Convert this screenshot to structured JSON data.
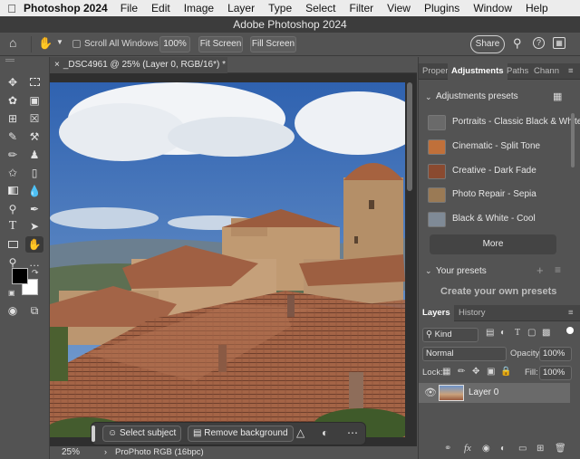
{
  "menubar": {
    "apple": "",
    "app": "Photoshop 2024",
    "items": [
      "File",
      "Edit",
      "Image",
      "Layer",
      "Type",
      "Select",
      "Filter",
      "View",
      "Plugins",
      "Window",
      "Help"
    ]
  },
  "window": {
    "title": "Adobe Photoshop 2024"
  },
  "options": {
    "scroll_all_windows": "Scroll All Windows",
    "zoom_100": "100%",
    "fit_screen": "Fit Screen",
    "fill_screen": "Fill Screen",
    "share": "Share"
  },
  "document": {
    "tab_label": "_DSC4961 @ 25% (Layer 0, RGB/16*) *",
    "zoom": "25%",
    "profile": "ProPhoto RGB (16bpc)"
  },
  "taskbar": {
    "select_subject": "Select subject",
    "remove_background": "Remove background"
  },
  "panels": {
    "top_tabs": [
      "Proper",
      "Adjustments",
      "Paths",
      "Chann"
    ],
    "adjustments_presets_title": "Adjustments presets",
    "presets": [
      {
        "label": "Portraits - Classic Black & White",
        "thumb": "#6a6a6a"
      },
      {
        "label": "Cinematic - Split Tone",
        "thumb": "#c0703a"
      },
      {
        "label": "Creative - Dark Fade",
        "thumb": "#8a4a30"
      },
      {
        "label": "Photo Repair - Sepia",
        "thumb": "#9a7a55"
      },
      {
        "label": "Black & White - Cool",
        "thumb": "#7f8a96"
      }
    ],
    "more": "More",
    "your_presets": "Your presets",
    "create_presets": "Create your own presets",
    "layers_tabs": [
      "Layers",
      "History"
    ],
    "kind": "Kind",
    "blend_mode": "Normal",
    "opacity_label": "Opacity:",
    "opacity_value": "100%",
    "lock_label": "Lock:",
    "fill_label": "Fill:",
    "fill_value": "100%",
    "layer_name": "Layer 0"
  },
  "colors": {
    "accent": "#535353",
    "dark": "#3c3c3c",
    "sky": "#3f72b8"
  }
}
